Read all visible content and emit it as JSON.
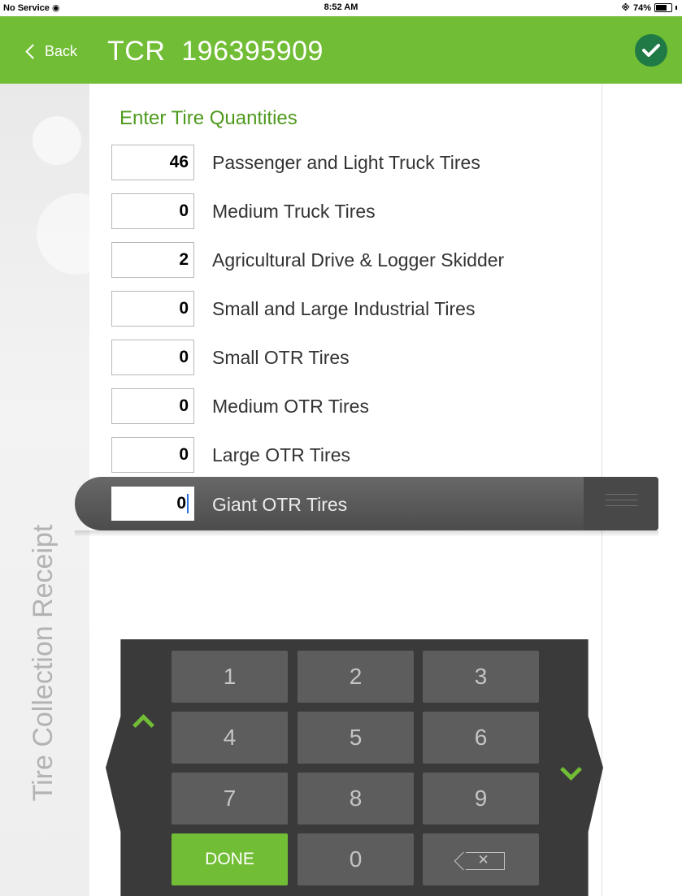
{
  "status_bar": {
    "carrier": "No Service",
    "time": "8:52 AM",
    "battery": "74%"
  },
  "nav": {
    "back_label": "Back",
    "title": "TCR  196395909"
  },
  "sidebar": {
    "label": "Tire Collection Receipt"
  },
  "form": {
    "title": "Enter Tire Quantities",
    "rows": [
      {
        "qty": "46",
        "label": "Passenger and Light Truck Tires"
      },
      {
        "qty": "0",
        "label": "Medium Truck Tires"
      },
      {
        "qty": "2",
        "label": "Agricultural Drive & Logger Skidder"
      },
      {
        "qty": "0",
        "label": "Small and Large Industrial Tires"
      },
      {
        "qty": "0",
        "label": "Small OTR Tires"
      },
      {
        "qty": "0",
        "label": "Medium OTR Tires"
      },
      {
        "qty": "0",
        "label": "Large OTR Tires"
      }
    ],
    "active_row": {
      "qty": "0",
      "label": "Giant OTR Tires"
    }
  },
  "keypad": {
    "keys": [
      "1",
      "2",
      "3",
      "4",
      "5",
      "6",
      "7",
      "8",
      "9"
    ],
    "done_label": "DONE",
    "zero_label": "0"
  },
  "colors": {
    "brand_green": "#72bd36",
    "confirm_green": "#1f7a45",
    "label_green": "#4f9a1e"
  }
}
